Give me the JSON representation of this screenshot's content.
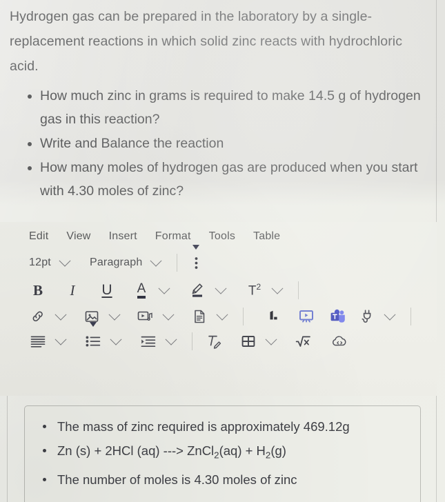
{
  "question": {
    "paragraph": "Hydrogen gas can be prepared in the laboratory by a single-replacement reactions in which solid zinc reacts with hydrochloric acid.",
    "bullets": [
      "How much zinc in grams is required to make 14.5 g of hydrogen gas in this reaction?",
      "Write and Balance the reaction",
      "How many moles of hydrogen gas are produced when you start with 4.30 moles of zinc?"
    ]
  },
  "editor": {
    "menubar": [
      "Edit",
      "View",
      "Insert",
      "Format",
      "Tools",
      "Table"
    ],
    "format_row": {
      "font_size": "12pt",
      "block_format": "Paragraph",
      "more_options": "⋮"
    },
    "inline_row": {
      "bold": "B",
      "italic": "I",
      "underline": "U",
      "text_color": "A",
      "highlight": "highlighter-icon",
      "superscript": "T2"
    },
    "insert_row": {
      "link": "link-icon",
      "image": "image-icon",
      "media": "media-icon",
      "document": "document-icon",
      "lti_tool": "lti-tool-icon",
      "screen_capture": "screen-capture-icon",
      "teams": "microsoft-teams-icon",
      "apps": "plug-apps-icon"
    },
    "paragraph_row": {
      "align": "align-icon",
      "bulleted_list": "bulleted-list-icon",
      "indent": "indent-icon",
      "clear_formatting": "clear-formatting-icon",
      "table": "table-icon",
      "math": "√x",
      "embed": "cloud-embed-icon"
    }
  },
  "answer": {
    "bullets": [
      {
        "segments": [
          {
            "t": "The mass of zinc required is approximately 469.12g"
          }
        ]
      },
      {
        "segments": [
          {
            "t": "Zn (s) + 2HCl (aq) ---> ZnCl"
          },
          {
            "t": "2",
            "sub": true
          },
          {
            "t": "(aq)  + H"
          },
          {
            "t": "2",
            "sub": true
          },
          {
            "t": "(g)"
          }
        ]
      },
      {
        "segments": [
          {
            "t": "The number of moles is 4.30 moles of zinc"
          }
        ]
      }
    ]
  },
  "colors": {
    "page_bg": "#e2e2de",
    "editor_bg": "#eeefe9",
    "question_text": "#6e6f70",
    "answer_text": "#3f4046",
    "teams_purple": "#5059c9",
    "capture_blue": "#6c7ad0",
    "icon_gray": "#4d4e56"
  }
}
